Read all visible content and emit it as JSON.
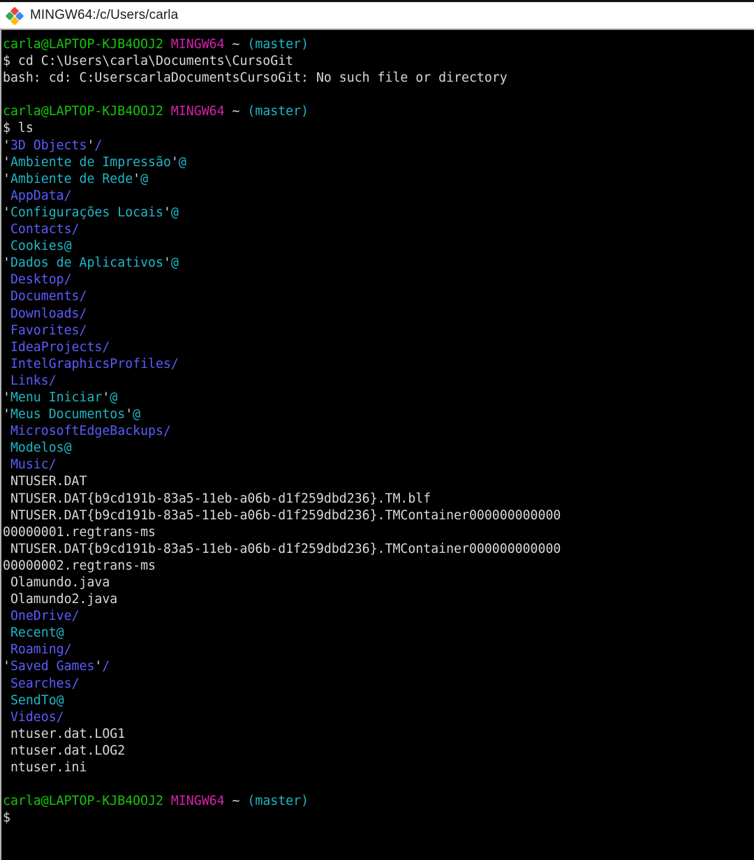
{
  "window": {
    "title": "MINGW64:/c/Users/carla",
    "icon": "git-bash-diamond-icon",
    "titlebar_bg": "#ffffff",
    "terminal_bg": "#000000"
  },
  "colors": {
    "user_host": "#16c60c",
    "shell_name": "#d520ae",
    "branch": "#1fb7c6",
    "directory": "#5c5cff",
    "symlink": "#1fb7c6",
    "plain_text": "#d9d9d9"
  },
  "terminal": {
    "prompt": {
      "user_host": "carla@LAPTOP-KJB4OOJ2",
      "shell": "MINGW64",
      "path": "~",
      "branch": "(master)",
      "symbol": "$"
    },
    "lines": [
      {
        "type": "prompt"
      },
      {
        "type": "command",
        "text": "$ cd C:\\Users\\carla\\Documents\\CursoGit"
      },
      {
        "type": "plain",
        "text": "bash: cd: C:UserscarlaDocumentsCursoGit: No such file or directory"
      },
      {
        "type": "blank"
      },
      {
        "type": "prompt"
      },
      {
        "type": "command",
        "text": "$ ls"
      },
      {
        "type": "entry",
        "quote": true,
        "name": "3D Objects",
        "suffix": "/",
        "kind": "dir"
      },
      {
        "type": "entry",
        "quote": true,
        "name": "Ambiente de Impressão",
        "suffix": "@",
        "kind": "link"
      },
      {
        "type": "entry",
        "quote": true,
        "name": "Ambiente de Rede",
        "suffix": "@",
        "kind": "link"
      },
      {
        "type": "entry",
        "quote": false,
        "name": "AppData",
        "suffix": "/",
        "kind": "dir"
      },
      {
        "type": "entry",
        "quote": true,
        "name": "Configurações Locais",
        "suffix": "@",
        "kind": "link"
      },
      {
        "type": "entry",
        "quote": false,
        "name": "Contacts",
        "suffix": "/",
        "kind": "dir"
      },
      {
        "type": "entry",
        "quote": false,
        "name": "Cookies",
        "suffix": "@",
        "kind": "link"
      },
      {
        "type": "entry",
        "quote": true,
        "name": "Dados de Aplicativos",
        "suffix": "@",
        "kind": "link"
      },
      {
        "type": "entry",
        "quote": false,
        "name": "Desktop",
        "suffix": "/",
        "kind": "dir"
      },
      {
        "type": "entry",
        "quote": false,
        "name": "Documents",
        "suffix": "/",
        "kind": "dir"
      },
      {
        "type": "entry",
        "quote": false,
        "name": "Downloads",
        "suffix": "/",
        "kind": "dir"
      },
      {
        "type": "entry",
        "quote": false,
        "name": "Favorites",
        "suffix": "/",
        "kind": "dir"
      },
      {
        "type": "entry",
        "quote": false,
        "name": "IdeaProjects",
        "suffix": "/",
        "kind": "dir"
      },
      {
        "type": "entry",
        "quote": false,
        "name": "IntelGraphicsProfiles",
        "suffix": "/",
        "kind": "dir"
      },
      {
        "type": "entry",
        "quote": false,
        "name": "Links",
        "suffix": "/",
        "kind": "dir"
      },
      {
        "type": "entry",
        "quote": true,
        "name": "Menu Iniciar",
        "suffix": "@",
        "kind": "link"
      },
      {
        "type": "entry",
        "quote": true,
        "name": "Meus Documentos",
        "suffix": "@",
        "kind": "link"
      },
      {
        "type": "entry",
        "quote": false,
        "name": "MicrosoftEdgeBackups",
        "suffix": "/",
        "kind": "dir"
      },
      {
        "type": "entry",
        "quote": false,
        "name": "Modelos",
        "suffix": "@",
        "kind": "link"
      },
      {
        "type": "entry",
        "quote": false,
        "name": "Music",
        "suffix": "/",
        "kind": "dir"
      },
      {
        "type": "entry",
        "quote": false,
        "name": "NTUSER.DAT",
        "suffix": "",
        "kind": "file"
      },
      {
        "type": "entry",
        "quote": false,
        "name": "NTUSER.DAT{b9cd191b-83a5-11eb-a06b-d1f259dbd236}.TM.blf",
        "suffix": "",
        "kind": "file"
      },
      {
        "type": "entry",
        "quote": false,
        "name": "NTUSER.DAT{b9cd191b-83a5-11eb-a06b-d1f259dbd236}.TMContainer00000000000000000001.regtrans-ms",
        "suffix": "",
        "kind": "file"
      },
      {
        "type": "entry",
        "quote": false,
        "name": "NTUSER.DAT{b9cd191b-83a5-11eb-a06b-d1f259dbd236}.TMContainer00000000000000000002.regtrans-ms",
        "suffix": "",
        "kind": "file"
      },
      {
        "type": "entry",
        "quote": false,
        "name": "Olamundo.java",
        "suffix": "",
        "kind": "file"
      },
      {
        "type": "entry",
        "quote": false,
        "name": "Olamundo2.java",
        "suffix": "",
        "kind": "file"
      },
      {
        "type": "entry",
        "quote": false,
        "name": "OneDrive",
        "suffix": "/",
        "kind": "dir"
      },
      {
        "type": "entry",
        "quote": false,
        "name": "Recent",
        "suffix": "@",
        "kind": "link"
      },
      {
        "type": "entry",
        "quote": false,
        "name": "Roaming",
        "suffix": "/",
        "kind": "dir"
      },
      {
        "type": "entry",
        "quote": true,
        "name": "Saved Games",
        "suffix": "/",
        "kind": "dir"
      },
      {
        "type": "entry",
        "quote": false,
        "name": "Searches",
        "suffix": "/",
        "kind": "dir"
      },
      {
        "type": "entry",
        "quote": false,
        "name": "SendTo",
        "suffix": "@",
        "kind": "link"
      },
      {
        "type": "entry",
        "quote": false,
        "name": "Videos",
        "suffix": "/",
        "kind": "dir"
      },
      {
        "type": "entry",
        "quote": false,
        "name": "ntuser.dat.LOG1",
        "suffix": "",
        "kind": "file"
      },
      {
        "type": "entry",
        "quote": false,
        "name": "ntuser.dat.LOG2",
        "suffix": "",
        "kind": "file"
      },
      {
        "type": "entry",
        "quote": false,
        "name": "ntuser.ini",
        "suffix": "",
        "kind": "file"
      },
      {
        "type": "blank"
      },
      {
        "type": "prompt"
      },
      {
        "type": "command",
        "text": "$"
      }
    ]
  }
}
